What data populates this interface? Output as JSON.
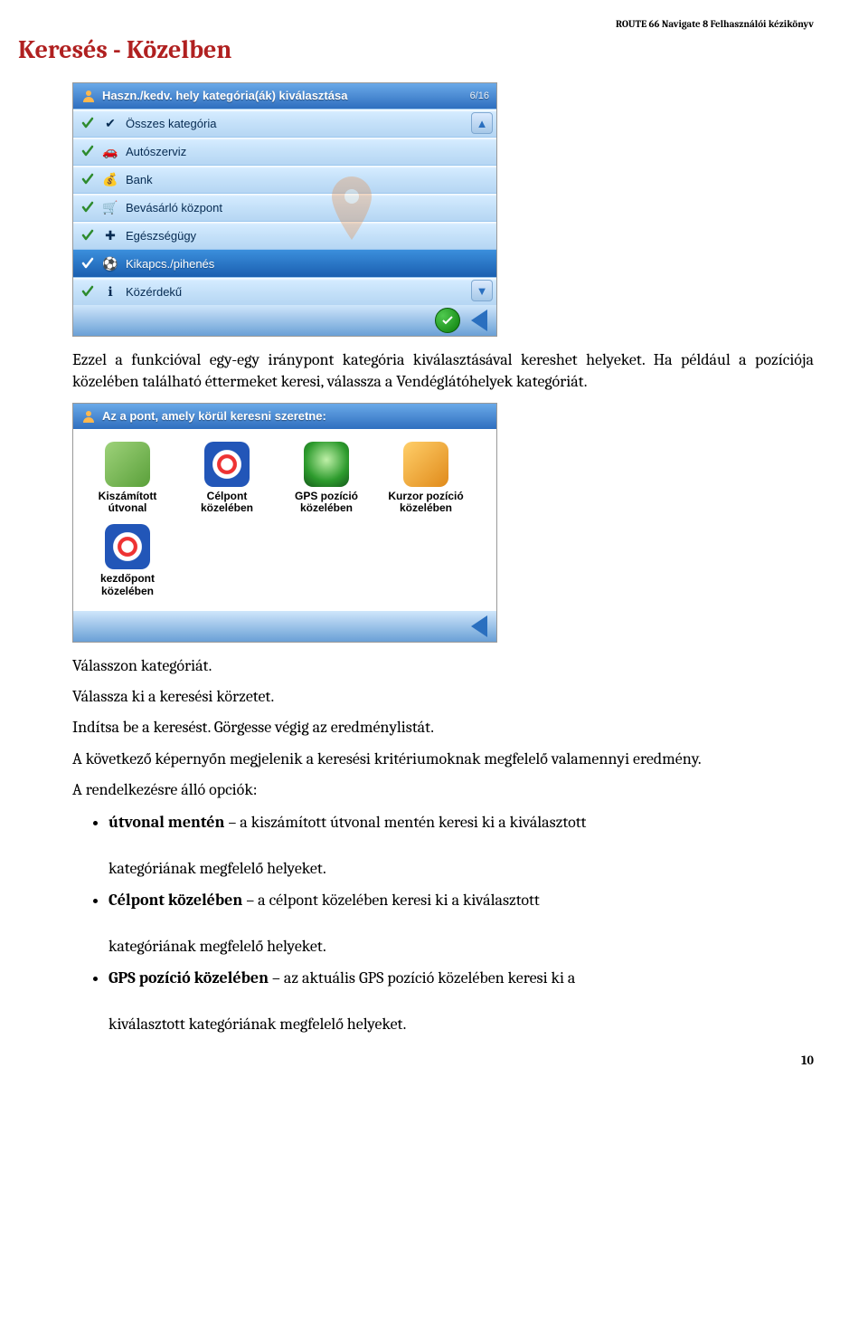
{
  "header": {
    "doc_title": "ROUTE 66 Navigate 8 Felhasználói kézikönyv"
  },
  "section": {
    "title": "Keresés - Közelben"
  },
  "shot1": {
    "title": "Haszn./kedv. hely kategória(ák) kiválasztása",
    "count": "6/16",
    "rows": [
      {
        "label": "Összes kategória",
        "icon_name": "all-icon"
      },
      {
        "label": "Autószerviz",
        "icon_name": "car-icon"
      },
      {
        "label": "Bank",
        "icon_name": "bank-icon"
      },
      {
        "label": "Bevásárló központ",
        "icon_name": "cart-icon"
      },
      {
        "label": "Egészségügy",
        "icon_name": "health-icon"
      },
      {
        "label": "Kikapcs./pihenés",
        "icon_name": "leisure-icon",
        "selected": true
      },
      {
        "label": "Közérdekű",
        "icon_name": "info-icon"
      }
    ]
  },
  "shot2": {
    "title": "Az a pont, amely körül keresni szeretne:",
    "cells_row1": [
      {
        "label": "Kiszámított útvonal",
        "icon_name": "route-icon",
        "css": "bg-map"
      },
      {
        "label": "Célpont közelében",
        "icon_name": "target-icon",
        "css": "bg-target"
      },
      {
        "label": "GPS pozíció közelében",
        "icon_name": "gps-icon",
        "css": "bg-gps"
      },
      {
        "label": "Kurzor pozíció közelében",
        "icon_name": "pin-icon",
        "css": "bg-pin"
      }
    ],
    "cells_row2": [
      {
        "label": "kezdőpont közelében",
        "icon_name": "start-icon",
        "css": "bg-target"
      }
    ]
  },
  "body": {
    "p1": "Ezzel a funkcióval egy-egy iránypont kategória kiválasztásával kereshet helyeket. Ha például a pozíciója közelében található éttermeket keresi, válassza a Vendéglátóhelyek kategóriát.",
    "p2": "Válasszon kategóriát.",
    "p3": "Válassza ki a keresési körzetet.",
    "p4": "Indítsa be a keresést. Görgesse végig az eredménylistát.",
    "p5": "A következő képernyőn megjelenik a keresési kritériumoknak megfelelő valamennyi eredmény.",
    "p6": "A rendelkezésre álló opciók:",
    "bullets": {
      "b1a": "útvonal mentén",
      "b1b": " – a kiszámított útvonal mentén keresi ki a kiválasztott",
      "b1c": "kategóriának megfelelő helyeket.",
      "b2a": "Célpont közelében",
      "b2b": " – a célpont közelében keresi ki a kiválasztott",
      "b2c": "kategóriának megfelelő helyeket.",
      "b3a": "GPS pozíció közelében",
      "b3b": " – az aktuális GPS pozíció közelében keresi ki a",
      "b3c": "kiválasztott kategóriának megfelelő helyeket."
    }
  },
  "footer": {
    "page": "10"
  }
}
